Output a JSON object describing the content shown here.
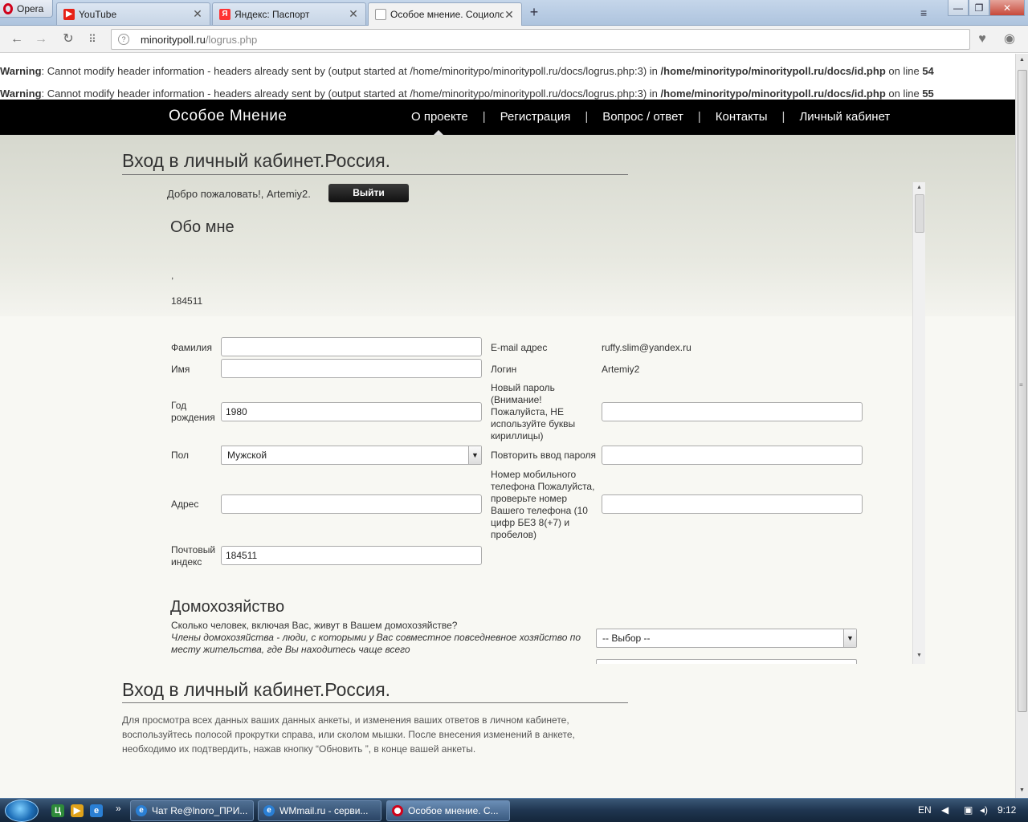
{
  "browser": {
    "app_label": "Opera",
    "tabs": [
      {
        "title": "YouTube",
        "favicon": "youtube-icon"
      },
      {
        "title": "Яндекс: Паспорт",
        "favicon": "yandex-icon"
      },
      {
        "title": "Особое мнение. Социолог",
        "favicon": "page-icon",
        "active": true
      }
    ],
    "url_host": "minoritypoll.ru",
    "url_path": "/logrus.php",
    "window_controls": [
      "minimize",
      "maximize",
      "close"
    ]
  },
  "warnings": [
    {
      "label": "Warning",
      "message": ": Cannot modify header information - headers already sent by (output started at /home/minoritypo/minoritypoll.ru/docs/logrus.php:3) in ",
      "file": "/home/minoritypo/minoritypoll.ru/docs/id.php",
      "on_line": " on line ",
      "line": "54"
    },
    {
      "label": "Warning",
      "message": ": Cannot modify header information - headers already sent by (output started at /home/minoritypo/minoritypoll.ru/docs/logrus.php:3) in ",
      "file": "/home/minoritypo/minoritypoll.ru/docs/id.php",
      "on_line": " on line ",
      "line": "55"
    }
  ],
  "site": {
    "logo": "Особое Мнение",
    "nav": [
      "О проекте",
      "Регистрация",
      "Вопрос / ответ",
      "Контакты",
      "Личный кабинет"
    ],
    "nav_separator": "|",
    "page_title": "Вход в личный кабинет.Россия.",
    "welcome_text": "Добро пожаловать!, Artemiy2.",
    "logout_label": "Выйти",
    "about_heading": "Обо мне",
    "dot_text": ",",
    "id_number": "184511",
    "form": {
      "last_name_label": "Фамилия",
      "last_name_value": "",
      "first_name_label": "Имя",
      "first_name_value": "",
      "birth_year_label": "Год рождения",
      "birth_year_value": "1980",
      "gender_label": "Пол",
      "gender_value": "Мужской",
      "address_label": "Адрес",
      "address_value": "",
      "postal_label": "Почтовый индекс",
      "postal_value": "184511",
      "email_label": "E-mail адрес",
      "email_value": "ruffy.slim@yandex.ru",
      "login_label": "Логин",
      "login_value": "Artemiy2",
      "new_password_label": "Новый пароль (Внимание! Пожалуйста, НЕ используйте буквы кириллицы)",
      "repeat_password_label": "Повторить ввод пароля",
      "mobile_label": "Номер мобильного телефона Пожалуйста, проверьте номер Вашего телефона (10 цифр БЕЗ 8(+7) и пробелов)"
    },
    "household": {
      "heading": "Домохозяйство",
      "question": "Сколько человек, включая Вас, живут в Вашем домохозяйстве?",
      "note": "Члены домохозяйства - люди, с которыми у Вас совместное повседневное хозяйство по месту жительства, где Вы находитесь чаще всего",
      "select_value": "-- Выбор --"
    },
    "bottom_title": "Вход в личный кабинет.Россия.",
    "bottom_text": "Для просмотра всех данных ваших данных анкеты, и изменения ваших ответов в личном кабинете, воспользуйтесь полосой прокрутки справа, или сколом мышки. После внесения изменений в анкете, необходимо их подтвердить, нажав кнопку “Обновить ”, в конце вашей анкеты."
  },
  "taskbar": {
    "tasks": [
      {
        "title": "Чат Re@lnoro_ПРИ...",
        "icon": "ie-icon"
      },
      {
        "title": "WMmail.ru - серви...",
        "icon": "ie-icon"
      },
      {
        "title": "Особое мнение. С...",
        "icon": "opera-icon",
        "active": true
      }
    ],
    "more": "»",
    "lang": "EN",
    "time": "9:12"
  },
  "colors": {
    "nav_bg": "#000000",
    "hero_bg": "#d6d8ce",
    "opera_red": "#d0021b"
  }
}
